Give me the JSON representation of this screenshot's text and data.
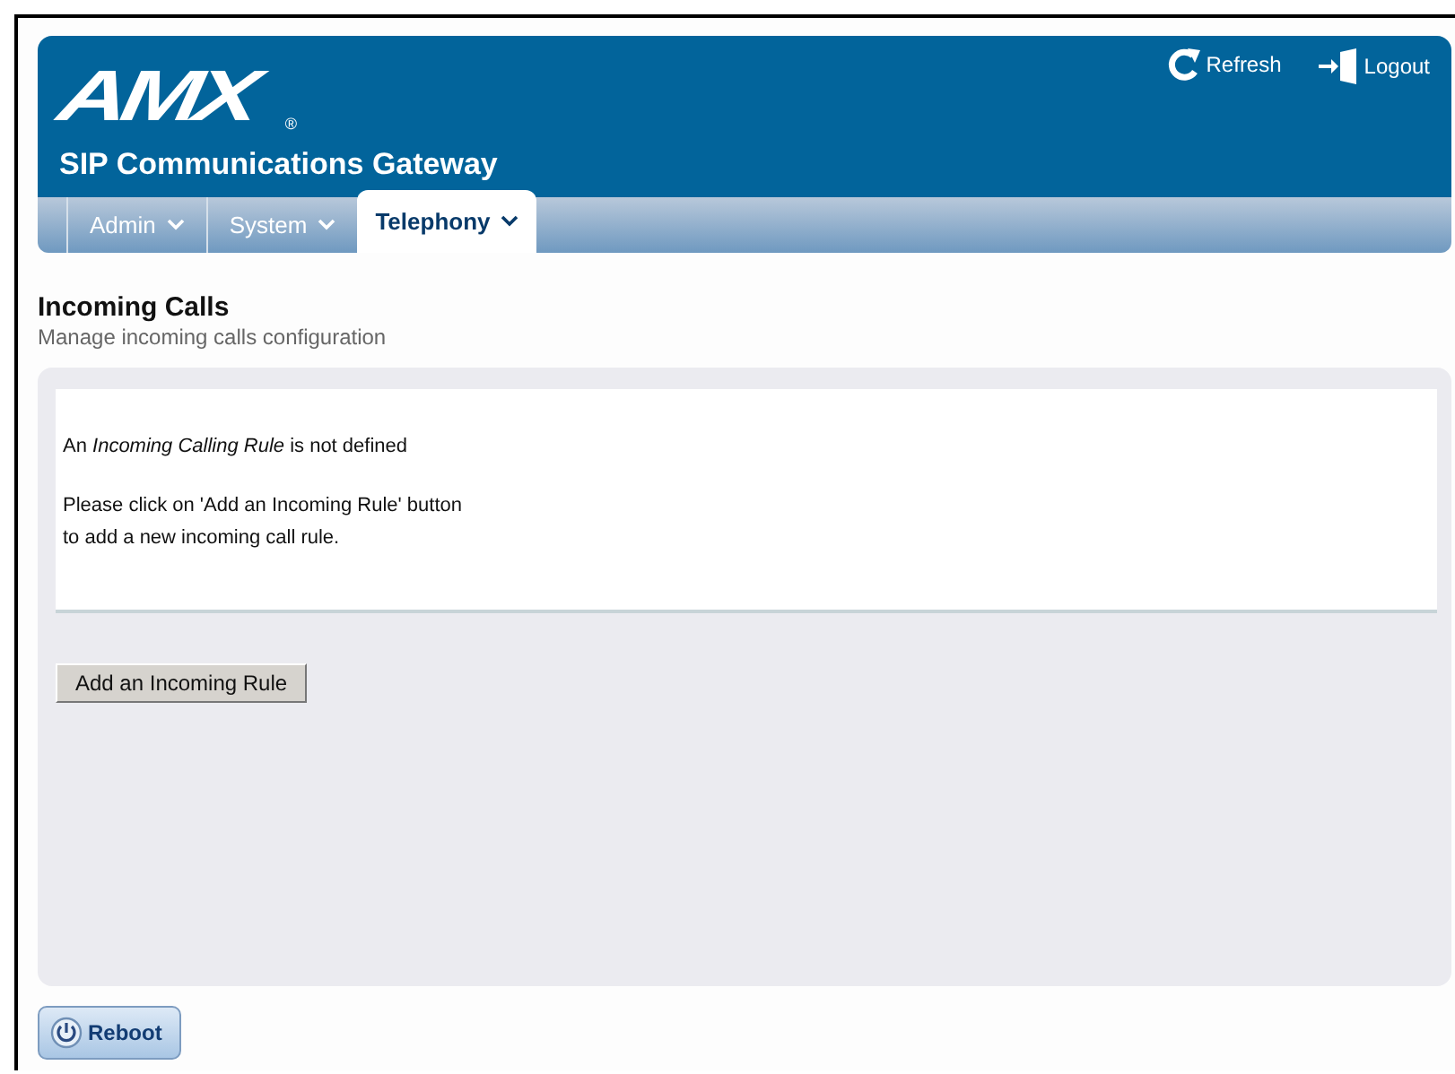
{
  "header": {
    "logo": "AMX",
    "logo_mark": "®",
    "product": "SIP Communications Gateway",
    "actions": [
      {
        "kind": "refresh",
        "label": "Refresh"
      },
      {
        "kind": "logout",
        "label": "Logout"
      }
    ]
  },
  "tabs": [
    {
      "label": "Admin",
      "selected": false
    },
    {
      "label": "System",
      "selected": false
    },
    {
      "label": "Telephony",
      "selected": true
    }
  ],
  "page": {
    "title": "Incoming Calls",
    "subtitle": "Manage incoming calls configuration"
  },
  "notice": {
    "status": "An *Incoming Calling Rule* is not defined",
    "instructions": [
      "Please click on 'Add an Incoming Rule' button",
      "to add a new incoming call rule."
    ]
  },
  "buttons": {
    "add": "Add an Incoming Rule",
    "reboot": "Reboot"
  }
}
